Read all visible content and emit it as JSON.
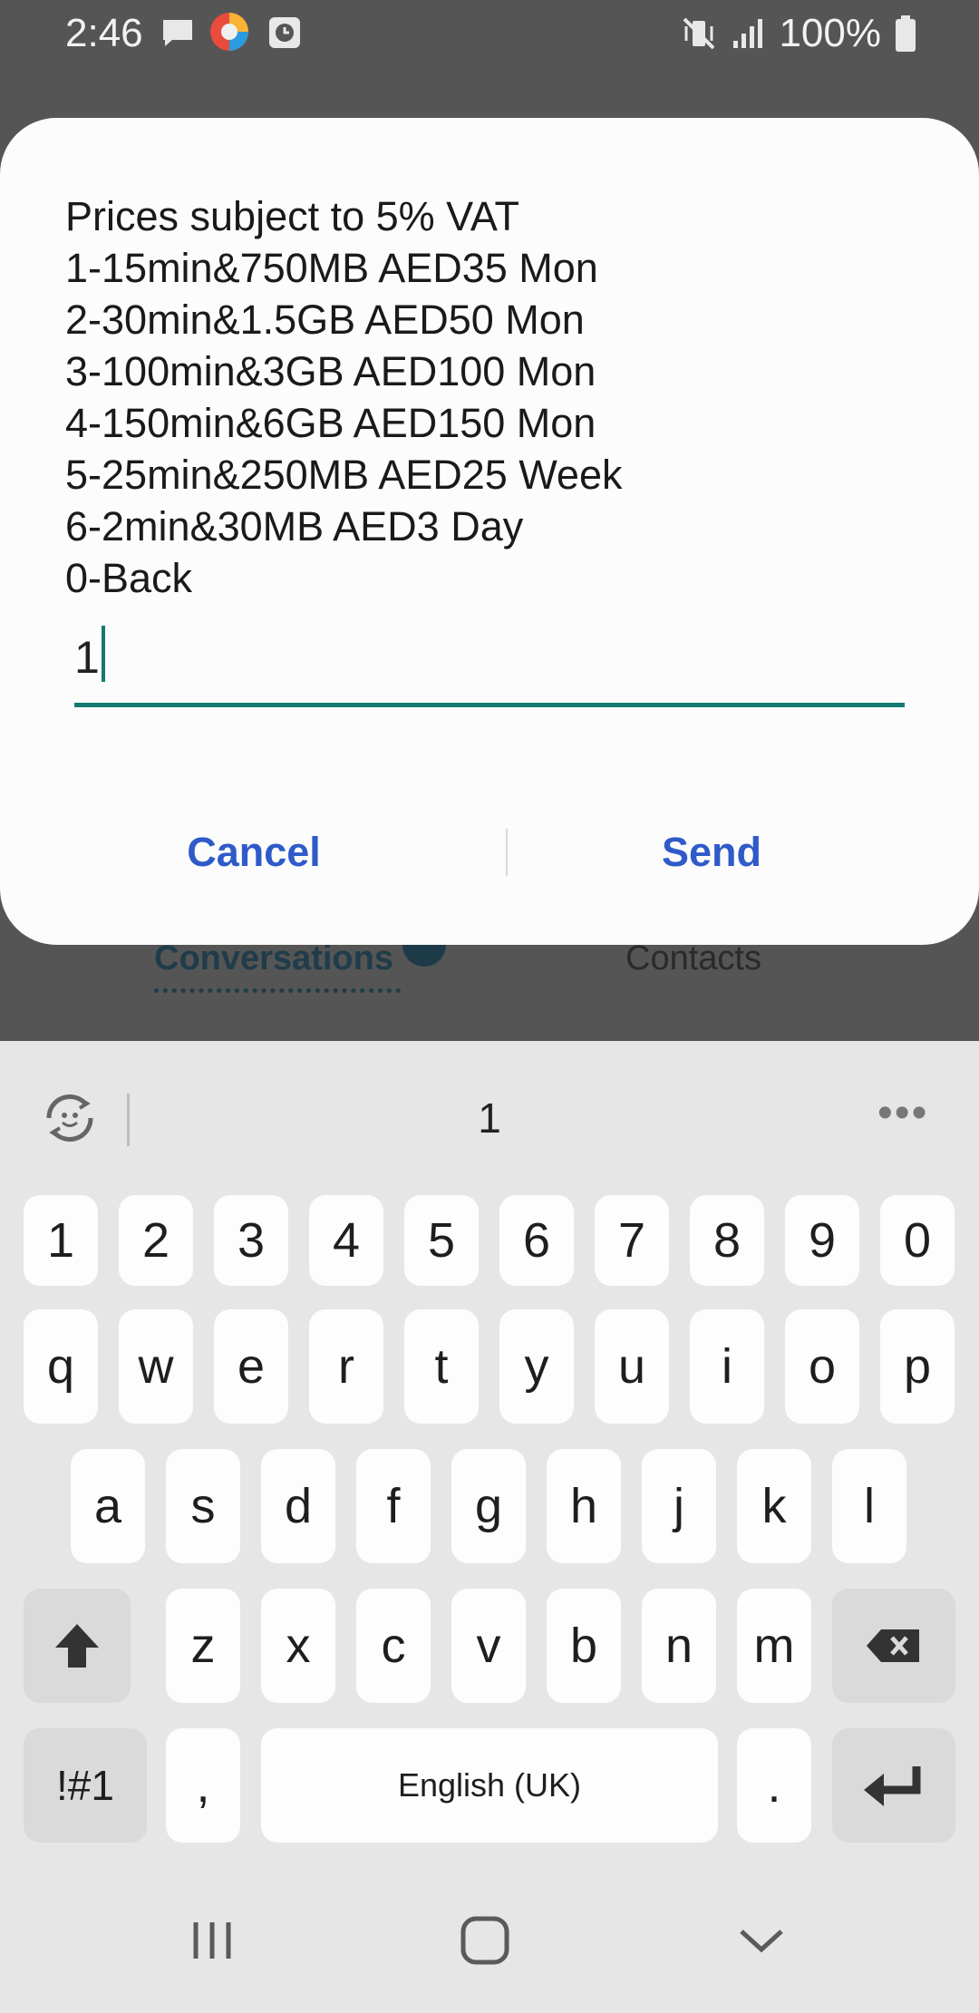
{
  "status_bar": {
    "time": "2:46",
    "battery_percent": "100%",
    "icons": [
      "message-icon",
      "browser-icon",
      "clock-app-icon",
      "vibrate-mute-icon",
      "signal-icon",
      "battery-icon"
    ]
  },
  "background_app": {
    "tabs": [
      {
        "label": "Conversations",
        "active": true
      },
      {
        "label": "Contacts",
        "active": false
      }
    ]
  },
  "dialog": {
    "message_lines": [
      "Prices subject to 5% VAT",
      "1-15min&750MB AED35 Mon",
      "2-30min&1.5GB AED50 Mon",
      "3-100min&3GB AED100 Mon",
      "4-150min&6GB AED150 Mon",
      "5-25min&250MB AED25 Week",
      "6-2min&30MB AED3 Day",
      "0-Back"
    ],
    "input_value": "1",
    "cancel_label": "Cancel",
    "send_label": "Send",
    "accent_color": "#137a72",
    "button_color": "#2f5bc9"
  },
  "keyboard": {
    "suggestion": "1",
    "more_label": "•••",
    "rows": {
      "numbers": [
        "1",
        "2",
        "3",
        "4",
        "5",
        "6",
        "7",
        "8",
        "9",
        "0"
      ],
      "row1": [
        "q",
        "w",
        "e",
        "r",
        "t",
        "y",
        "u",
        "i",
        "o",
        "p"
      ],
      "row2": [
        "a",
        "s",
        "d",
        "f",
        "g",
        "h",
        "j",
        "k",
        "l"
      ],
      "row3": [
        "z",
        "x",
        "c",
        "v",
        "b",
        "n",
        "m"
      ]
    },
    "symbols_label": "!#1",
    "comma_label": ",",
    "space_label": "English (UK)",
    "period_label": "."
  },
  "nav_bar": {
    "icons": [
      "recent-apps-icon",
      "home-icon",
      "back-icon"
    ]
  }
}
